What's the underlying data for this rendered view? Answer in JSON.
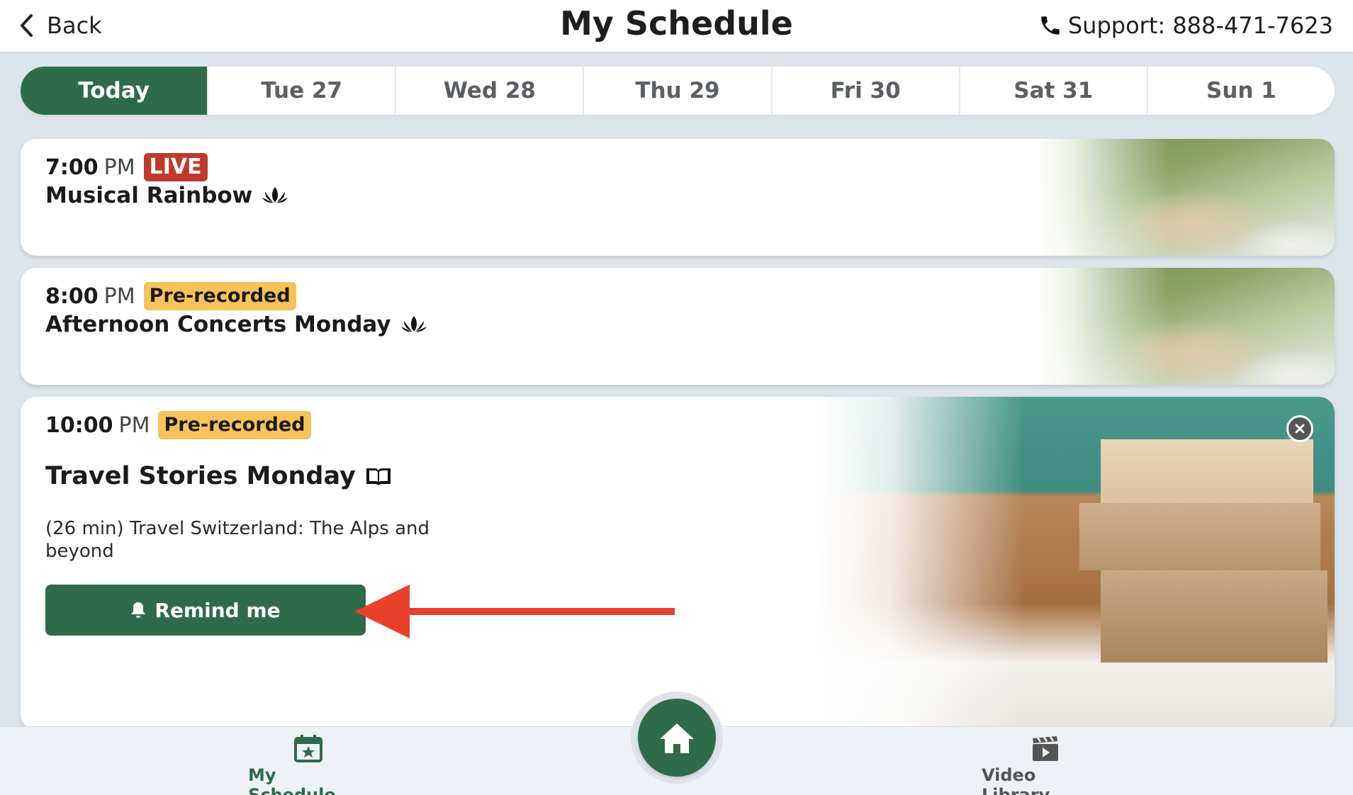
{
  "header": {
    "back_label": "Back",
    "title": "My Schedule",
    "support_label": "Support: 888-471-7623"
  },
  "tabs": [
    {
      "label": "Today",
      "active": true
    },
    {
      "label": "Tue 27",
      "active": false
    },
    {
      "label": "Wed 28",
      "active": false
    },
    {
      "label": "Thu 29",
      "active": false
    },
    {
      "label": "Fri 30",
      "active": false
    },
    {
      "label": "Sat 31",
      "active": false
    },
    {
      "label": "Sun 1",
      "active": false
    }
  ],
  "events": [
    {
      "time": "7:00",
      "ampm": "PM",
      "badge": "LIVE",
      "title": "Musical Rainbow",
      "icon": "lotus-icon"
    },
    {
      "time": "8:00",
      "ampm": "PM",
      "badge": "Pre-recorded",
      "title": "Afternoon Concerts Monday",
      "icon": "lotus-icon"
    },
    {
      "time": "10:00",
      "ampm": "PM",
      "badge": "Pre-recorded",
      "title": "Travel Stories Monday",
      "icon": "book-icon",
      "description": "(26 min) Travel Switzerland: The Alps and beyond",
      "remind_label": "Remind me"
    }
  ],
  "bottom_nav": {
    "schedule_label": "My Schedule",
    "library_label": "Video Library"
  },
  "colors": {
    "brand_green": "#2e6b4b",
    "live_red": "#c0392b",
    "prerecorded_yellow": "#f6c35b",
    "annotation_arrow": "#e8412c"
  }
}
